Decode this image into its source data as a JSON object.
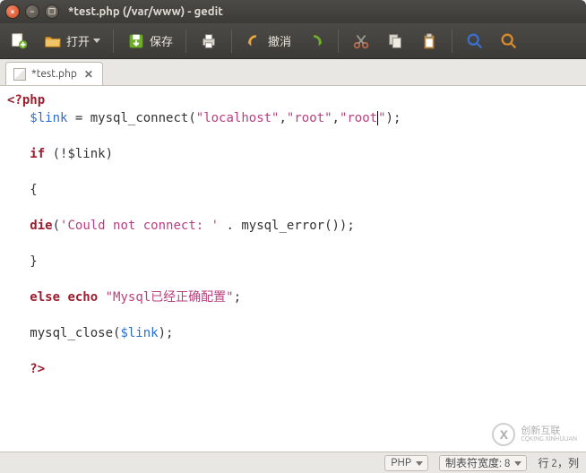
{
  "window": {
    "title": "*test.php (/var/www) - gedit"
  },
  "toolbar": {
    "open_label": "打开",
    "save_label": "保存",
    "undo_label": "撤消"
  },
  "tab": {
    "filename": "*test.php"
  },
  "code": {
    "l1_open": "<?php",
    "l1_var": "$link",
    "l1_assign": " = ",
    "l1_fn": "mysql_connect",
    "l1_p1": "(",
    "l1_s1": "\"localhost\"",
    "l1_c1": ",",
    "l1_s2": "\"root\"",
    "l1_c2": ",",
    "l1_s3": "\"root",
    "l1_s3b": "\"",
    "l1_p2": ");",
    "l3_if": "if",
    "l3_rest": " (!$link)",
    "l5_brace": "{",
    "l7_die": "die",
    "l7_p1": "(",
    "l7_s1": "'Could not connect: '",
    "l7_dot": " . ",
    "l7_fn": "mysql_error",
    "l7_p2": "());",
    "l9_brace": "}",
    "l11_else": "else",
    "l11_echo": " echo",
    "l11_sp": " ",
    "l11_str": "\"Mysql已经正确配置\"",
    "l11_semi": ";",
    "l13_fn": "mysql_close",
    "l13_p1": "(",
    "l13_var": "$link",
    "l13_p2": ");",
    "l15_close": "?>"
  },
  "status": {
    "language": "PHP",
    "tabwidth": "制表符宽度: 8",
    "rowcol": "行 2，列"
  },
  "watermark": {
    "main": "创新互联",
    "sub": "CQKING XINHULIAN"
  }
}
